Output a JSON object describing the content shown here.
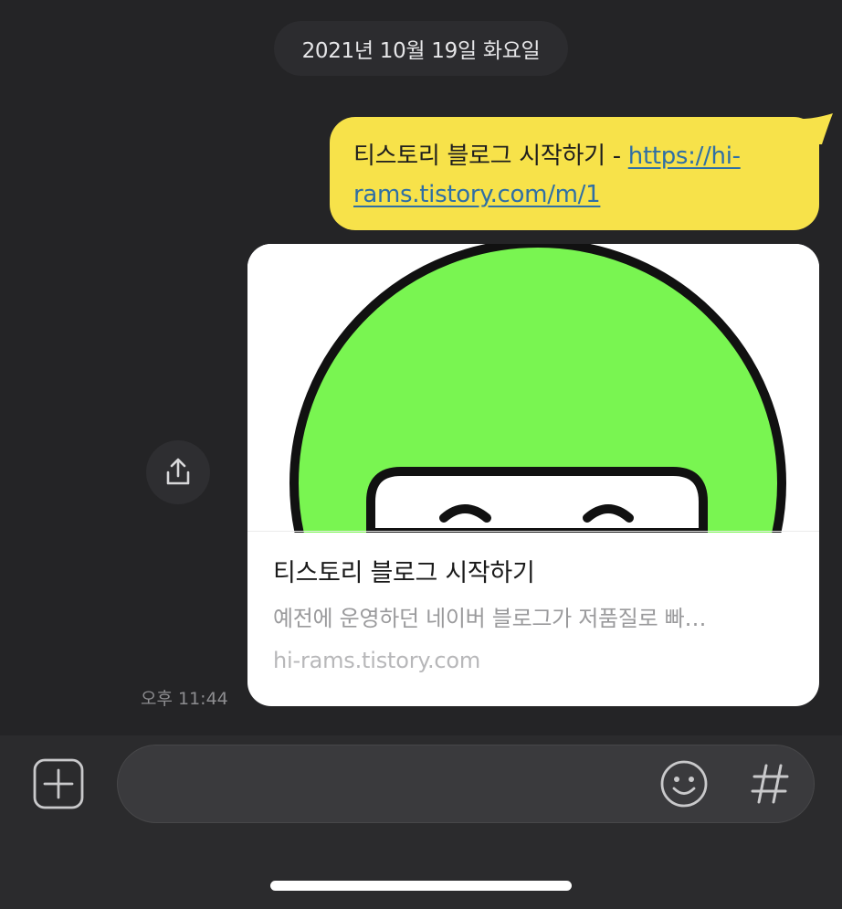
{
  "date_divider": "2021년 10월 19일 화요일",
  "message": {
    "text_prefix": "티스토리 블로그 시작하기 - ",
    "link_part1": "https://hi-",
    "link_part2": "rams.tistory.com/m/1"
  },
  "link_preview": {
    "title": "티스토리 블로그 시작하기",
    "description": "예전에 운영하던 네이버 블로그가 저품질로 빠…",
    "domain": "hi-rams.tistory.com"
  },
  "timestamp": "오후 11:44",
  "icons": {
    "share": "share-icon",
    "plus": "plus-icon",
    "emoji": "emoji-icon",
    "hash": "hash-icon"
  },
  "colors": {
    "background": "#242426",
    "bubble": "#f7e24a",
    "link": "#2f6fa5",
    "thumbnail_green": "#79f551"
  }
}
